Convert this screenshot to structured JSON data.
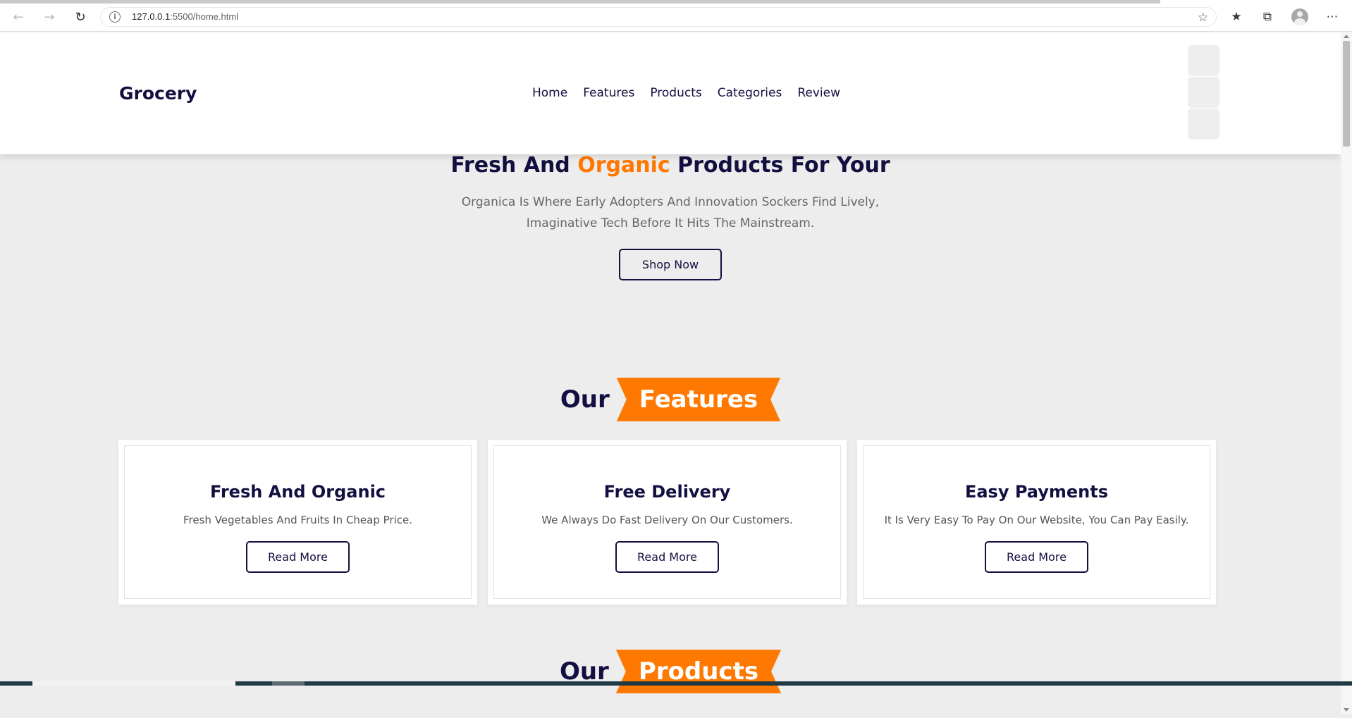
{
  "browser": {
    "url_host": "127.0.0.1",
    "url_path": ":5500/home.html"
  },
  "header": {
    "logo": "Grocery",
    "nav": [
      "Home",
      "Features",
      "Products",
      "Categories",
      "Review"
    ]
  },
  "hero": {
    "title_before": "Fresh And ",
    "title_accent": "Organic",
    "title_after": " Products For Your",
    "text": "Organica Is Where Early Adopters And Innovation Sockers Find Lively, Imaginative Tech Before It Hits The Mainstream.",
    "button": "Shop Now"
  },
  "features_heading": {
    "plain": "Our",
    "ribbon": "Features"
  },
  "features": [
    {
      "title": "Fresh And Organic",
      "text": "Fresh Vegetables And Fruits In Cheap Price.",
      "button": "Read More"
    },
    {
      "title": "Free Delivery",
      "text": "We Always Do Fast Delivery On Our Customers.",
      "button": "Read More"
    },
    {
      "title": "Easy Payments",
      "text": "It Is Very Easy To Pay On Our Website, You Can Pay Easily.",
      "button": "Read More"
    }
  ],
  "products_heading": {
    "plain": "Our",
    "ribbon": "Products"
  },
  "colors": {
    "accent": "#ff7800",
    "navy": "#130f40",
    "page_bg": "#ededed"
  }
}
